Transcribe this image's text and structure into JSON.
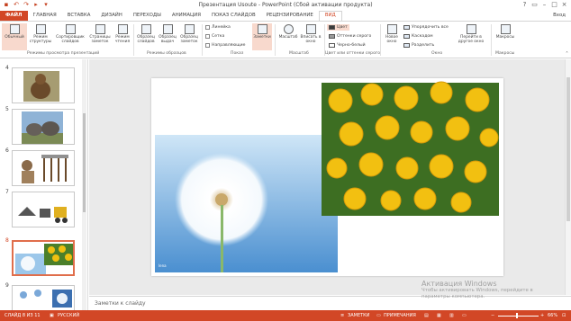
{
  "window": {
    "title": "Презентация Usoute - PowerPoint (Сбой активации продукта)",
    "quick_access": [
      "save-icon",
      "undo-icon",
      "redo-icon",
      "start-from-beginning-icon",
      "customize-icon"
    ],
    "controls": [
      "help-icon",
      "ribbon-options-icon",
      "minimize-icon",
      "maximize-icon",
      "close-icon"
    ]
  },
  "tabs": {
    "file": "ФАЙЛ",
    "items": [
      "ГЛАВНАЯ",
      "ВСТАВКА",
      "ДИЗАЙН",
      "ПЕРЕХОДЫ",
      "АНИМАЦИЯ",
      "ПОКАЗ СЛАЙДОВ",
      "РЕЦЕНЗИРОВАНИЕ",
      "ВИД"
    ],
    "active": "ВИД",
    "account": "Вход"
  },
  "ribbon": {
    "view_modes": [
      "Обычный",
      "Режим структуры",
      "Сортировщик слайдов",
      "Страницы заметок",
      "Режим чтения"
    ],
    "master_views": [
      "Образец слайдов",
      "Образец выдач",
      "Образец заметок"
    ],
    "show": [
      "Линейка",
      "Сетка",
      "Направляющие"
    ],
    "notes": "Заметки",
    "zoom": [
      "Масштаб",
      "Вписать в окно"
    ],
    "color": [
      "Цвет",
      "Оттенки серого",
      "Черно-белый"
    ],
    "window": [
      "Новое окно",
      "Упорядочить все",
      "Каскадом",
      "Разделить"
    ],
    "switch_windows": "Перейти в другое окно",
    "macros": "Макросы",
    "group_labels": [
      "Режимы просмотра презентаций",
      "Режимы образцов",
      "Показ",
      "Масштаб",
      "Цвет или оттенки серого",
      "Окно",
      "Макросы"
    ]
  },
  "thumbnails": {
    "numbers": [
      "4",
      "5",
      "6",
      "7",
      "8",
      "9"
    ],
    "selected": "8"
  },
  "slide": {
    "image_credit": "lena"
  },
  "notes": {
    "placeholder": "Заметки к слайду"
  },
  "watermark": {
    "line1": "Активация Windows",
    "line2": "Чтобы активировать Windows, перейдите в",
    "line3": "параметры компьютера."
  },
  "status": {
    "slide": "СЛАЙД 8 ИЗ 11",
    "language": "РУССКИЙ",
    "notes": "ЗАМЕТКИ",
    "comments": "ПРИМЕЧАНИЯ",
    "zoom_minus": "−",
    "zoom_plus": "+",
    "zoom_level": "66%"
  },
  "colors": {
    "accent": "#d24726",
    "selected_fill": "#f8d9cd"
  }
}
